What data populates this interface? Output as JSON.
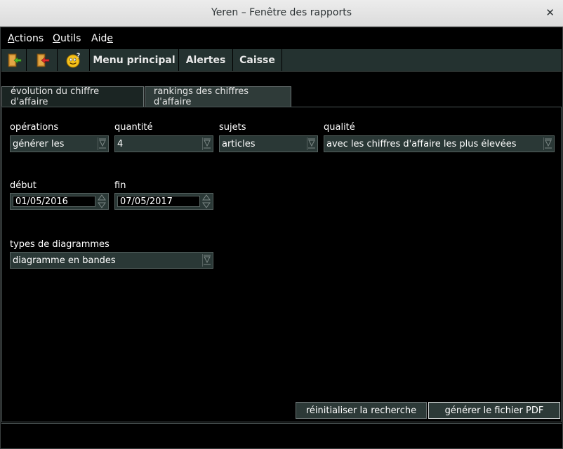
{
  "window": {
    "title": "Yeren – Fenêtre des rapports",
    "close_icon": "close-icon"
  },
  "menubar": {
    "items": [
      {
        "prefix": "",
        "mnemonic": "A",
        "suffix": "ctions"
      },
      {
        "prefix": "",
        "mnemonic": "O",
        "suffix": "utils"
      },
      {
        "prefix": "Aid",
        "mnemonic": "e",
        "suffix": ""
      }
    ]
  },
  "toolbar": {
    "icons": [
      "exit-door-icon",
      "back-door-icon",
      "smiley-help-icon"
    ],
    "menu_principal": "Menu principal",
    "alertes": "Alertes",
    "caisse": "Caisse"
  },
  "tabs": [
    {
      "label": "évolution du chiffre d'affaire"
    },
    {
      "label": "rankings des chiffres d'affaire"
    }
  ],
  "form": {
    "operations": {
      "label": "opérations",
      "value": "générer les"
    },
    "quantite": {
      "label": "quantité",
      "value": "4"
    },
    "sujets": {
      "label": "sujets",
      "value": "articles"
    },
    "qualite": {
      "label": "qualité",
      "value": "avec les chiffres d'affaire les plus élevées"
    },
    "debut": {
      "label": "début",
      "value": "01/05/2016"
    },
    "fin": {
      "label": "fin",
      "value": "07/05/2017"
    },
    "types": {
      "label": "types de diagrammes",
      "value": "diagramme en bandes"
    }
  },
  "actions": {
    "reset": "réinitialiser la recherche",
    "generate_pdf": "générer le fichier PDF"
  },
  "colors": {
    "background": "#000000",
    "toolbar": "#243230",
    "control": "#2a3836"
  }
}
